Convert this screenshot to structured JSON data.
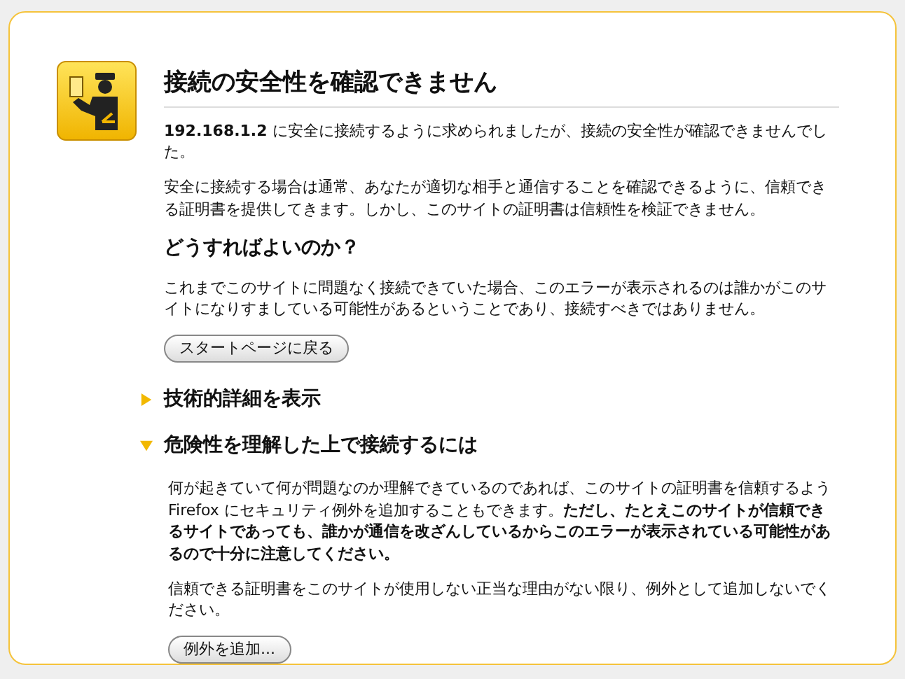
{
  "title": "接続の安全性を確認できません",
  "intro": [
    "**192.168.1.2** に安全に接続するように求められましたが、接続の安全性が確認できませんでした。",
    "安全に接続する場合は通常、あなたが適切な相手と通信することを確認できるように、信頼できる証明書を提供してきます。しかし、このサイトの証明書は信頼性を検証できません。"
  ],
  "what_to_do": {
    "heading": "どうすればよいのか？",
    "text": "これまでこのサイトに問題なく接続できていた場合、このエラーが表示されるのは誰かがこのサイトになりすましている可能性があるということであり、接続すべきではありません。",
    "button": "スタートページに戻る"
  },
  "sections": [
    {
      "heading": "技術的詳細を表示",
      "expanded": false
    },
    {
      "heading": "危険性を理解した上で接続するには",
      "expanded": true,
      "paragraphs": [
        "何が起きていて何が問題なのか理解できているのであれば、このサイトの証明書を信頼するよう Firefox にセキュリティ例外を追加することもできます。**ただし、たとえこのサイトが信頼できるサイトであっても、誰かが通信を改ざんしているからこのエラーが表示されている可能性があるので十分に注意してください。**",
        "信頼できる証明書をこのサイトが使用しない正当な理由がない限り、例外として追加しないでください。"
      ],
      "button": "例外を追加..."
    }
  ]
}
